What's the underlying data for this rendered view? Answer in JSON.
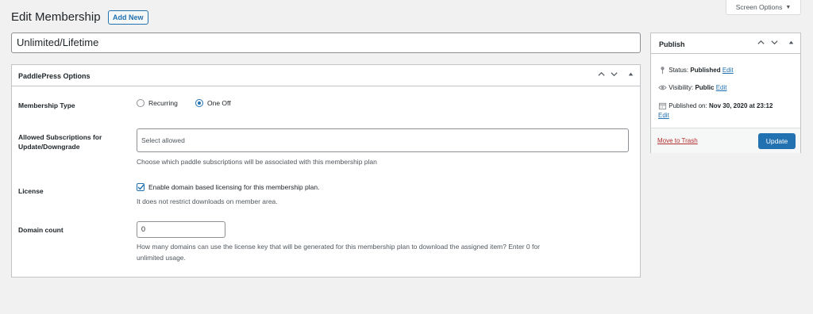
{
  "header": {
    "title": "Edit Membership",
    "add_new": "Add New",
    "screen_options": "Screen Options",
    "screen_options_caret": "▼"
  },
  "title_input": {
    "value": "Unlimited/Lifetime"
  },
  "metabox": {
    "title": "PaddlePress Options",
    "membership_type": {
      "label": "Membership Type",
      "options": [
        "Recurring",
        "One Off"
      ],
      "selected": "One Off"
    },
    "allowed_subscriptions": {
      "label_line1": "Allowed Subscriptions for",
      "label_line2": "Update/Downgrade",
      "placeholder": "Select allowed",
      "description": "Choose which paddle subscriptions will be associated with this membership plan"
    },
    "license": {
      "label": "License",
      "checkbox_label": "Enable domain based licensing for this membership plan.",
      "checked": true,
      "description": "It does not restrict downloads on member area."
    },
    "domain_count": {
      "label": "Domain count",
      "value": "0",
      "description_line1": "How many domains can use the license key that will be generated for this membership plan to download the assigned item? Enter 0 for",
      "description_line2": "unlimited usage."
    }
  },
  "publish": {
    "title": "Publish",
    "status_label": "Status:",
    "status_value": "Published",
    "visibility_label": "Visibility:",
    "visibility_value": "Public",
    "published_label": "Published on:",
    "published_value": "Nov 30, 2020 at 23:12",
    "edit": "Edit",
    "move_to_trash": "Move to Trash",
    "update": "Update"
  },
  "colors": {
    "accent": "#2271b1",
    "danger": "#b32d2e",
    "background": "#f1f1f1"
  }
}
